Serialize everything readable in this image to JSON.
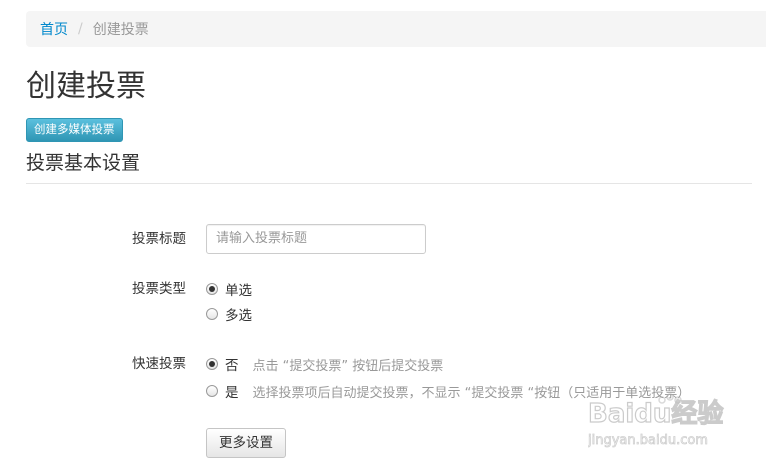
{
  "breadcrumb": {
    "home": "首页",
    "separator": "/",
    "current": "创建投票"
  },
  "page": {
    "title": "创建投票",
    "media_button": "创建多媒体投票",
    "section_title": "投票基本设置"
  },
  "form": {
    "title_field": {
      "label": "投票标题",
      "placeholder": "请输入投票标题",
      "value": ""
    },
    "type_field": {
      "label": "投票类型",
      "options": [
        {
          "label": "单选",
          "checked": true
        },
        {
          "label": "多选",
          "checked": false
        }
      ]
    },
    "quick_vote": {
      "label": "快速投票",
      "options": [
        {
          "label": "否",
          "hint": "点击 “提交投票” 按钮后提交投票",
          "checked": true
        },
        {
          "label": "是",
          "hint": "选择投票项后自动提交投票，不显示 “提交投票 “按钮（只适用于单选投票）",
          "checked": false
        }
      ]
    },
    "more_button": "更多设置"
  },
  "watermark": {
    "brand": "Baidu经验",
    "url": "jingyan.baidu.com"
  },
  "colors": {
    "link": "#0088cc",
    "info_button": "#2f96b4",
    "hint_text": "#999999"
  }
}
